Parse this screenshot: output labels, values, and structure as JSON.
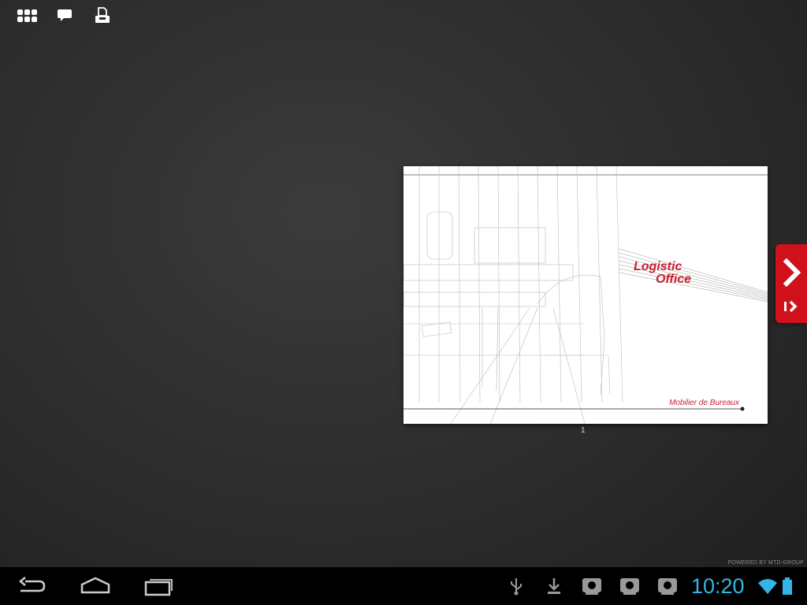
{
  "toolbar": {
    "icons": [
      "grid-menu-icon",
      "comment-icon",
      "print-icon"
    ]
  },
  "document": {
    "brand_line1": "Logistic",
    "brand_line2": "Office",
    "subtitle": "Mobilier de Bureaux",
    "page_number": "1"
  },
  "navigation": {
    "next_icon": "chevron-right-icon",
    "last_icon": "skip-to-end-icon"
  },
  "footer": {
    "powered_by": "POWERED BY MTD-GROUP"
  },
  "system_bar": {
    "time": "10:20",
    "time_color": "#33b5e5",
    "nav_icons": [
      "back-icon",
      "home-icon",
      "recent-apps-icon"
    ],
    "notification_icons": [
      "usb-icon",
      "download-icon",
      "app-notification-icon",
      "app-notification-icon",
      "app-notification-icon"
    ],
    "status_icons": [
      "wifi-icon",
      "battery-icon"
    ]
  },
  "colors": {
    "accent": "#d0111b",
    "brand_text": "#c8202c",
    "background": "#2c2c2c"
  }
}
